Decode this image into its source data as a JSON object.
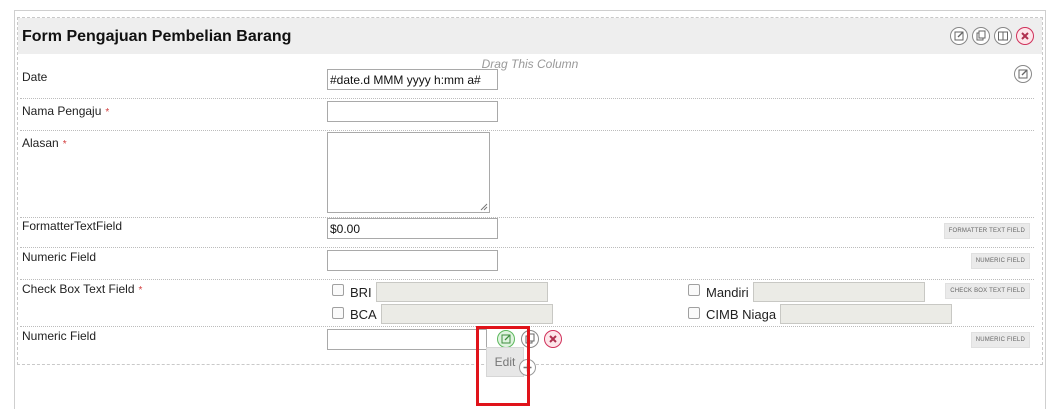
{
  "section": {
    "title": "Form Pengajuan Pembelian Barang",
    "drag_label": "Drag This Column"
  },
  "fields": [
    {
      "label": "Date",
      "required": false,
      "value": "#date.d MMM yyyy h:mm a#",
      "type": "text"
    },
    {
      "label": "Nama Pengaju",
      "required": true,
      "value": "",
      "type": "text"
    },
    {
      "label": "Alasan",
      "required": true,
      "value": "",
      "type": "textarea"
    },
    {
      "label": "FormatterTextField",
      "required": false,
      "value": "$0.00",
      "type": "text",
      "tag": "FORMATTER TEXT FIELD"
    },
    {
      "label": "Numeric Field",
      "required": false,
      "value": "",
      "type": "text",
      "tag": "NUMERIC FIELD"
    },
    {
      "label": "Check Box Text Field",
      "required": true,
      "type": "checkbox",
      "tag": "CHECK BOX TEXT FIELD",
      "options": [
        "BRI",
        "BCA",
        "Mandiri",
        "CIMB Niaga"
      ]
    },
    {
      "label": "Numeric Field",
      "required": false,
      "value": "",
      "type": "text",
      "tag": "NUMERIC FIELD"
    }
  ],
  "required_marker": "*",
  "tooltip": {
    "edit": "Edit"
  },
  "colors": {
    "required": "#d23c3c",
    "highlight": "#e0131a",
    "edit_green": "#5cb85c",
    "close_pink": "#d0305a"
  }
}
